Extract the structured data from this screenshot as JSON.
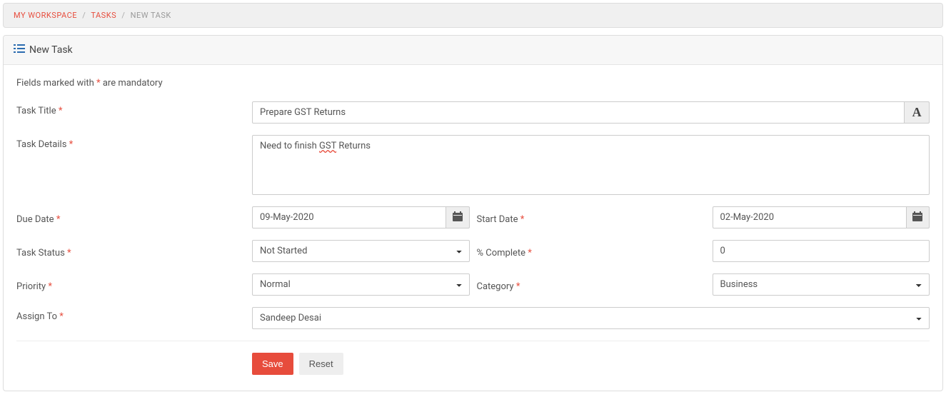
{
  "breadcrumb": {
    "items": [
      "MY WORKSPACE",
      "TASKS",
      "NEW TASK"
    ]
  },
  "panel": {
    "title": "New Task"
  },
  "mandatory_note": {
    "prefix": "Fields marked with ",
    "asterisk": "*",
    "suffix": " are mandatory"
  },
  "labels": {
    "task_title": "Task Title",
    "task_details": "Task Details",
    "due_date": "Due Date",
    "start_date": "Start Date",
    "task_status": "Task Status",
    "percent_complete": "% Complete",
    "priority": "Priority",
    "category": "Category",
    "assign_to": "Assign To"
  },
  "values": {
    "task_title": "Prepare GST Returns",
    "task_details_prefix": "Need to finish ",
    "task_details_highlight": "GST",
    "task_details_suffix": " Returns",
    "due_date": "09-May-2020",
    "start_date": "02-May-2020",
    "task_status": "Not Started",
    "percent_complete": "0",
    "priority": "Normal",
    "category": "Business",
    "assign_to": "Sandeep Desai"
  },
  "buttons": {
    "save": "Save",
    "reset": "Reset"
  }
}
